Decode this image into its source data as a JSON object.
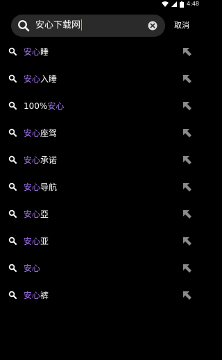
{
  "status_bar": {
    "time": "4:48",
    "icons": [
      "wifi-icon",
      "signal-icon",
      "battery-icon"
    ]
  },
  "search": {
    "query": "安心下载网",
    "cancel_label": "取消"
  },
  "colors": {
    "highlight": "#a779f5",
    "background": "#000000",
    "search_box": "#2a2a2a"
  },
  "suggestions": [
    {
      "prefix": "",
      "match": "安心",
      "suffix": "睡"
    },
    {
      "prefix": "",
      "match": "安心",
      "suffix": "入睡"
    },
    {
      "prefix": "100%",
      "match": "安心",
      "suffix": ""
    },
    {
      "prefix": "",
      "match": "安心",
      "suffix": "座驾"
    },
    {
      "prefix": "",
      "match": "安心",
      "suffix": "承诺"
    },
    {
      "prefix": "",
      "match": "安心",
      "suffix": "导航"
    },
    {
      "prefix": "",
      "match": "安心",
      "suffix": "亞"
    },
    {
      "prefix": "",
      "match": "安心",
      "suffix": "亚"
    },
    {
      "prefix": "",
      "match": "安心",
      "suffix": ""
    },
    {
      "prefix": "",
      "match": "安心",
      "suffix": "裤"
    }
  ]
}
